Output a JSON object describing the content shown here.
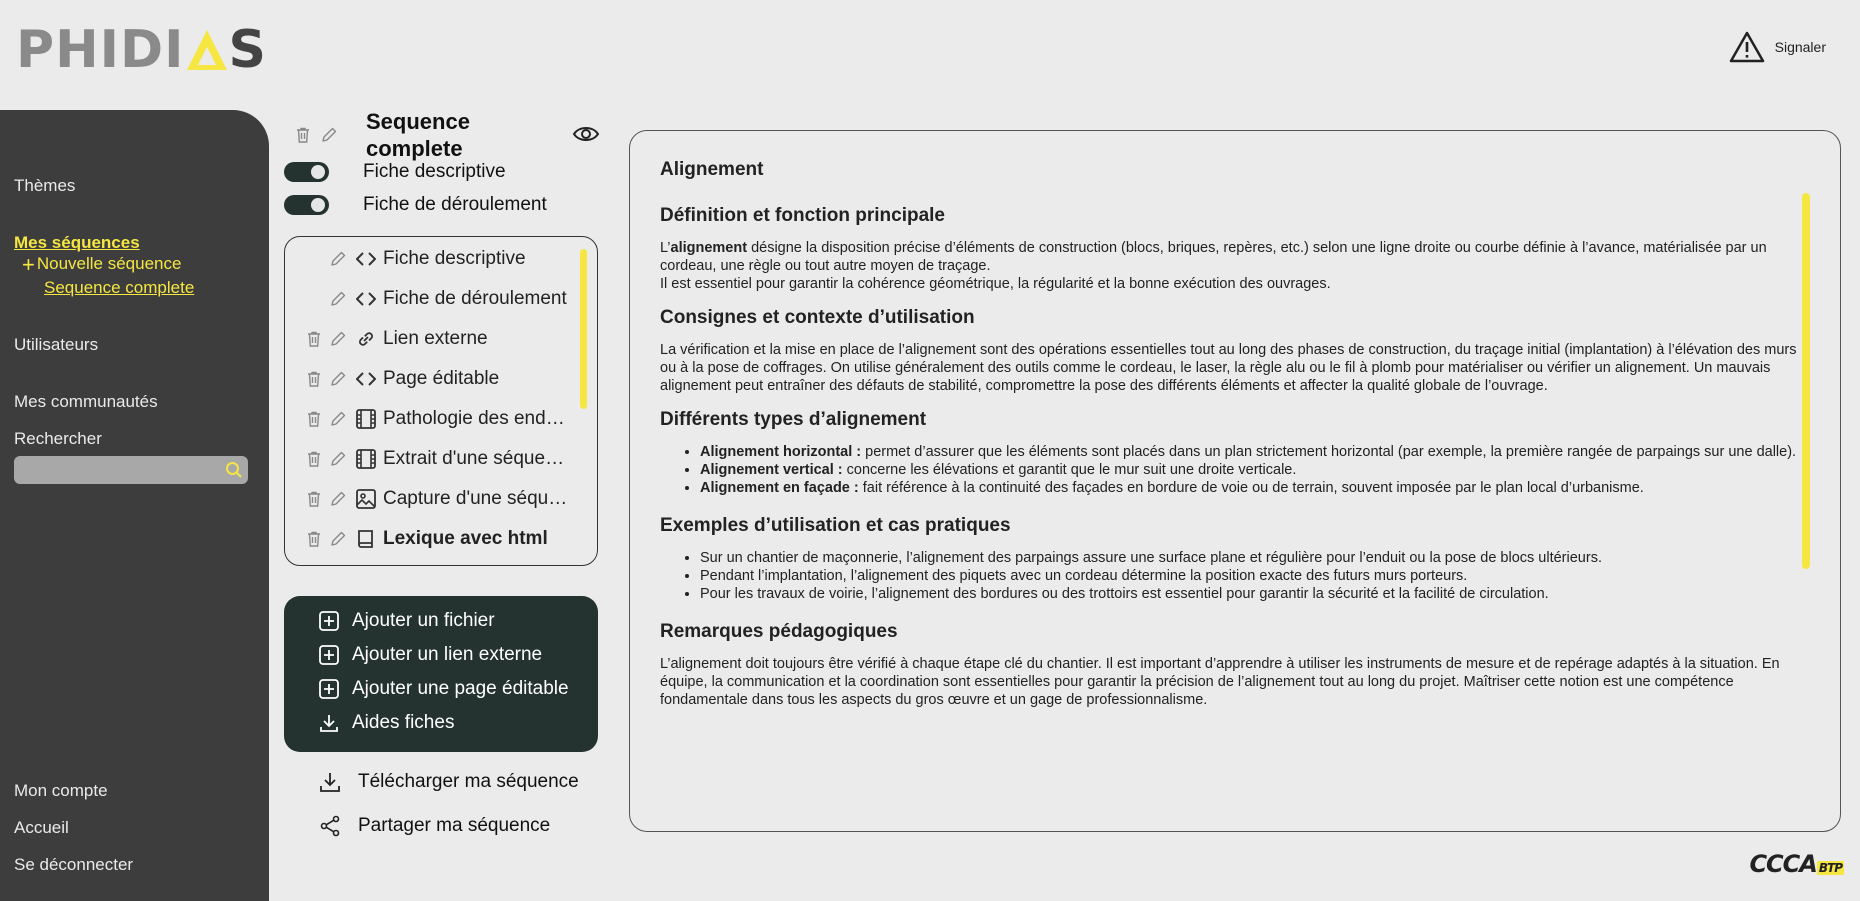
{
  "header": {
    "logo_text_1": "PHIDI",
    "logo_text_2": "S",
    "report_label": "Signaler"
  },
  "sidebar": {
    "themes": "Thèmes",
    "my_sequences": "Mes séquences",
    "new_sequence": "Nouvelle séquence",
    "current_sequence": "Sequence complete",
    "users": "Utilisateurs",
    "communities": "Mes communautés",
    "search_label": "Rechercher",
    "search_value": "",
    "account": "Mon compte",
    "home": "Accueil",
    "logout": "Se déconnecter"
  },
  "sequence": {
    "title": "Sequence complete",
    "toggles": [
      {
        "label": "Fiche descriptive",
        "on": true
      },
      {
        "label": "Fiche de déroulement",
        "on": true
      }
    ],
    "files": [
      {
        "name": "Fiche descriptive",
        "type": "code",
        "deletable": false,
        "bold": false
      },
      {
        "name": "Fiche de déroulement",
        "type": "code",
        "deletable": false,
        "bold": false
      },
      {
        "name": "Lien externe",
        "type": "link",
        "deletable": true,
        "bold": false
      },
      {
        "name": "Page éditable",
        "type": "code",
        "deletable": true,
        "bold": false
      },
      {
        "name": "Pathologie des enduits",
        "type": "film",
        "deletable": true,
        "bold": false
      },
      {
        "name": "Extrait d'une séquence",
        "type": "film",
        "deletable": true,
        "bold": false
      },
      {
        "name": "Capture d'une séquence",
        "type": "image",
        "deletable": true,
        "bold": false
      },
      {
        "name": "Lexique avec html",
        "type": "book",
        "deletable": true,
        "bold": true
      }
    ],
    "actions": {
      "add_file": "Ajouter un fichier",
      "add_link": "Ajouter un lien externe",
      "add_page": "Ajouter une page éditable",
      "help": "Aides fiches"
    },
    "download": "Télécharger ma séquence",
    "share": "Partager ma séquence"
  },
  "article": {
    "title": "Alignement",
    "s1_title": "Définition et fonction principale",
    "s1_p1_pre": "L’",
    "s1_p1_bold": "alignement",
    "s1_p1_post": " désigne la disposition précise d’éléments de construction (blocs, briques, repères, etc.) selon une ligne droite ou courbe définie à l’avance, matérialisée par un cordeau, une règle ou tout autre moyen de traçage.",
    "s1_p2": "Il est essentiel pour garantir la cohérence géométrique, la régularité et la bonne exécution des ouvrages.",
    "s2_title": "Consignes et contexte d’utilisation",
    "s2_p": "La vérification et la mise en place de l’alignement sont des opérations essentielles tout au long des phases de construction, du traçage initial (implantation) à l’élévation des murs ou à la pose de coffrages. On utilise généralement des outils comme le cordeau, le laser, la règle alu ou le fil à plomb pour matérialiser ou vérifier un alignement. Un mauvais alignement peut entraîner des défauts de stabilité, compromettre la pose des différents éléments et affecter la qualité globale de l’ouvrage.",
    "s3_title": "Différents types d’alignement",
    "s3_items": [
      {
        "bold": "Alignement horizontal :",
        "text": " permet d’assurer que les éléments sont placés dans un plan strictement horizontal (par exemple, la première rangée de parpaings sur une dalle)."
      },
      {
        "bold": "Alignement vertical :",
        "text": " concerne les élévations et garantit que le mur suit une droite verticale."
      },
      {
        "bold": "Alignement en façade :",
        "text": " fait référence à la continuité des façades en bordure de voie ou de terrain, souvent imposée par le plan local d’urbanisme."
      }
    ],
    "s4_title": "Exemples d’utilisation et cas pratiques",
    "s4_items": [
      "Sur un chantier de maçonnerie, l’alignement des parpaings assure une surface plane et régulière pour l’enduit ou la pose de blocs ultérieurs.",
      "Pendant l’implantation, l’alignement des piquets avec un cordeau détermine la position exacte des futurs murs porteurs.",
      "Pour les travaux de voirie, l’alignement des bordures ou des trottoirs est essentiel pour garantir la sécurité et la facilité de circulation."
    ],
    "s5_title": "Remarques pédagogiques",
    "s5_p": "L’alignement doit toujours être vérifié à chaque étape clé du chantier. Il est important d’apprendre à utiliser les instruments de mesure et de repérage adaptés à la situation. En équipe, la communication et la coordination sont essentielles pour garantir la précision de l’alignement tout au long du projet. Maîtriser cette notion est une compétence fondamentale dans tous les aspects du gros œuvre et un gage de professionnalisme."
  },
  "footer": {
    "brand": "CCCA",
    "brand_sub": "BTP"
  },
  "colors": {
    "accent": "#f5e642",
    "dark_panel": "#243330",
    "sidebar": "#3d3d3d",
    "background": "#ebebeb"
  }
}
